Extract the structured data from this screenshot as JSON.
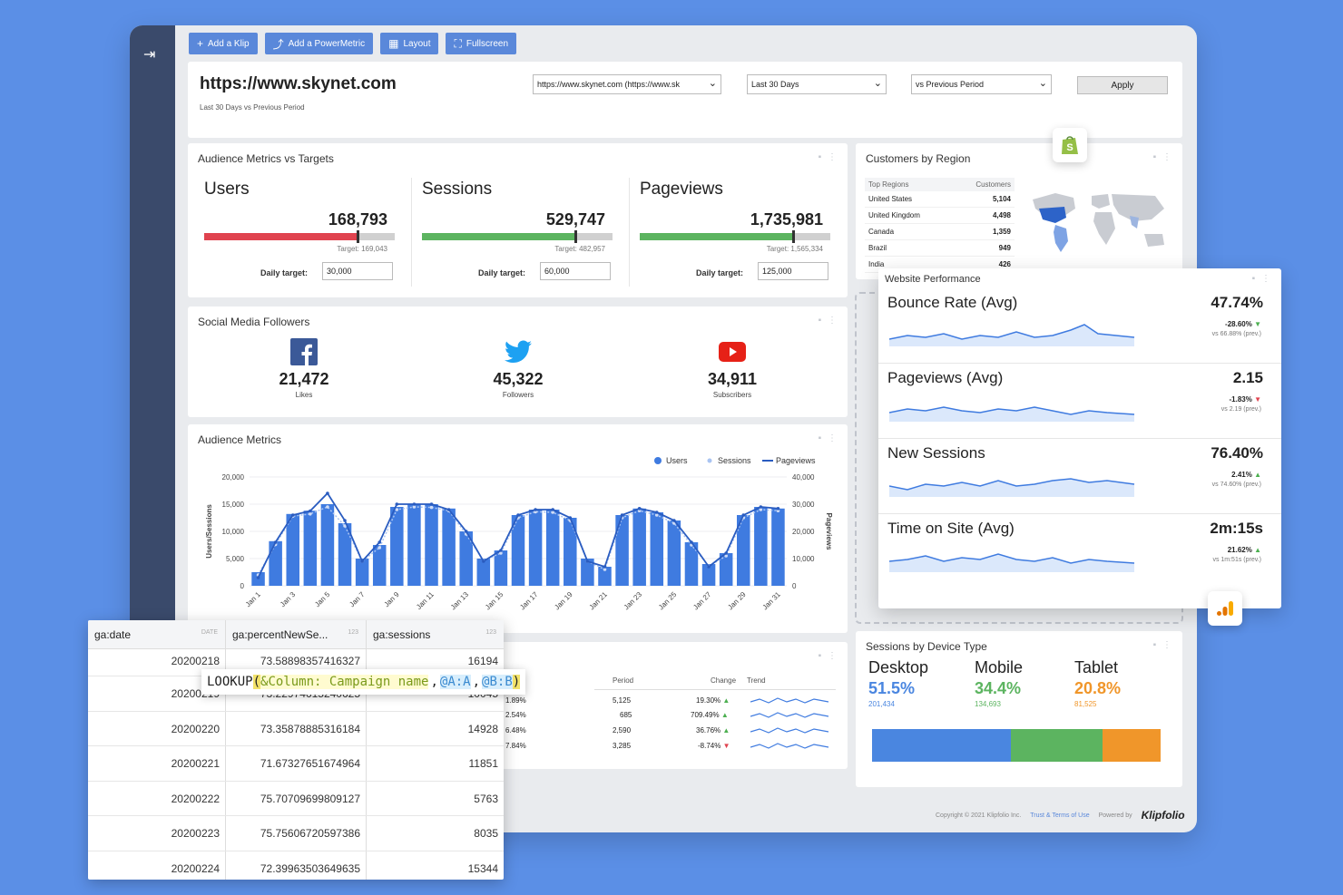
{
  "toolbar": {
    "add_klip": "Add a Klip",
    "add_powermetric": "Add a PowerMetric",
    "layout": "Layout",
    "fullscreen": "Fullscreen"
  },
  "header": {
    "title": "https://www.skynet.com",
    "subtitle": "Last 30 Days vs Previous Period",
    "site_select": "https://www.skynet.com (https://www.sk",
    "range_select": "Last 30 Days",
    "compare_select": "vs Previous Period",
    "apply": "Apply"
  },
  "targets": {
    "title": "Audience Metrics vs Targets",
    "daily_target_label": "Daily target:",
    "metrics": [
      {
        "name": "Users",
        "value": "168,793",
        "target": "Target: 169,043",
        "daily": "30,000",
        "fill": 0.8,
        "color": "#e0434f"
      },
      {
        "name": "Sessions",
        "value": "529,747",
        "target": "Target: 482,957",
        "daily": "60,000",
        "fill": 0.8,
        "color": "#5cb460"
      },
      {
        "name": "Pageviews",
        "value": "1,735,981",
        "target": "Target: 1,565,334",
        "daily": "125,000",
        "fill": 0.8,
        "color": "#5cb460"
      }
    ]
  },
  "social": {
    "title": "Social Media Followers",
    "items": [
      {
        "icon": "facebook-icon",
        "value": "21,472",
        "label": "Likes"
      },
      {
        "icon": "twitter-icon",
        "value": "45,322",
        "label": "Followers"
      },
      {
        "icon": "youtube-icon",
        "value": "34,911",
        "label": "Subscribers"
      }
    ]
  },
  "regions": {
    "title": "Customers by Region",
    "col1": "Top Regions",
    "col2": "Customers",
    "rows": [
      {
        "name": "United States",
        "value": "5,104"
      },
      {
        "name": "United Kingdom",
        "value": "4,498"
      },
      {
        "name": "Canada",
        "value": "1,359"
      },
      {
        "name": "Brazil",
        "value": "949"
      },
      {
        "name": "India",
        "value": "426"
      }
    ]
  },
  "website_performance": {
    "title": "Website Performance",
    "rows": [
      {
        "name": "Bounce Rate (Avg)",
        "value": "47.74%",
        "change": "-28.60%",
        "dir": "down",
        "prev": "vs 66.88% (prev.)"
      },
      {
        "name": "Pageviews (Avg)",
        "value": "2.15",
        "change": "-1.83%",
        "dir": "down",
        "prev": "vs 2.19 (prev.)"
      },
      {
        "name": "New Sessions",
        "value": "76.40%",
        "change": "2.41%",
        "dir": "up",
        "prev": "vs 74.60% (prev.)"
      },
      {
        "name": "Time on Site (Avg)",
        "value": "2m:15s",
        "change": "21.62%",
        "dir": "up",
        "prev": "vs 1m:51s (prev.)"
      }
    ]
  },
  "devices": {
    "title": "Sessions by Device Type",
    "items": [
      {
        "name": "Desktop",
        "pct": "51.5%",
        "count": "201,434",
        "color": "#4a86e0",
        "share": 0.48
      },
      {
        "name": "Mobile",
        "pct": "34.4%",
        "count": "134,693",
        "color": "#5cb460",
        "share": 0.32
      },
      {
        "name": "Tablet",
        "pct": "20.8%",
        "count": "81,525",
        "color": "#f0962a",
        "share": 0.2
      }
    ]
  },
  "campaign": {
    "period_header": "Period",
    "change_header": "Change",
    "trend_header": "Trend",
    "rows": [
      {
        "pct": "1.89%",
        "period": "5,125",
        "change": "19.30%",
        "dir": "up"
      },
      {
        "pct": "2.54%",
        "period": "685",
        "change": "709.49%",
        "dir": "up"
      },
      {
        "pct": "6.48%",
        "period": "2,590",
        "change": "36.76%",
        "dir": "up"
      },
      {
        "pct": "7.84%",
        "period": "3,285",
        "change": "-8.74%",
        "dir": "down"
      }
    ]
  },
  "datatable": {
    "headers": [
      {
        "name": "ga:date",
        "type": "DATE"
      },
      {
        "name": "ga:percentNewSe...",
        "type": "123"
      },
      {
        "name": "ga:sessions",
        "type": "123"
      }
    ],
    "rows": [
      [
        "20200218",
        "73.58898357416327",
        "16194"
      ],
      [
        "20200219",
        "73.22974615240625",
        "10045"
      ],
      [
        "20200220",
        "73.35878885316184",
        "14928"
      ],
      [
        "20200221",
        "71.67327651674964",
        "11851"
      ],
      [
        "20200222",
        "75.70709699809127",
        "5763"
      ],
      [
        "20200223",
        "75.75606720597386",
        "8035"
      ],
      [
        "20200224",
        "72.39963503649635",
        "15344"
      ]
    ]
  },
  "formula": {
    "fn": "LOOKUP",
    "open": "(",
    "arg1": "&Column: Campaign name",
    "sep": ",",
    "arg2": "@A:A",
    "arg3": "@B:B",
    "close": ")"
  },
  "footer": {
    "copyright": "Copyright © 2021 Klipfolio Inc.",
    "terms": "Trust & Terms of Use",
    "powered": "Powered by",
    "brand": "Klipfolio"
  },
  "colors": {
    "accent": "#5a88da",
    "bar": "#3f7be0",
    "line": "#2a5cc0",
    "up": "#4caf50",
    "down": "#e0434f"
  },
  "chart_data": {
    "type": "bar",
    "title": "Audience Metrics",
    "ylabel": "Users/Sessions",
    "y2label": "Pageviews",
    "ylim": [
      0,
      20000
    ],
    "y2lim": [
      0,
      40000
    ],
    "yticks": [
      "20,000",
      "15,000",
      "10,000",
      "5,000",
      "0"
    ],
    "y2ticks": [
      "40,000",
      "30,000",
      "20,000",
      "10,000",
      "0"
    ],
    "legend": [
      "Users",
      "Sessions",
      "Pageviews"
    ],
    "categories": [
      "Jan 1",
      "Jan 2",
      "Jan 3",
      "Jan 4",
      "Jan 5",
      "Jan 6",
      "Jan 7",
      "Jan 8",
      "Jan 9",
      "Jan 10",
      "Jan 11",
      "Jan 12",
      "Jan 13",
      "Jan 14",
      "Jan 15",
      "Jan 16",
      "Jan 17",
      "Jan 18",
      "Jan 19",
      "Jan 20",
      "Jan 21",
      "Jan 22",
      "Jan 23",
      "Jan 24",
      "Jan 25",
      "Jan 26",
      "Jan 27",
      "Jan 28",
      "Jan 29",
      "Jan 30",
      "Jan 31"
    ],
    "xticks": [
      "Jan 1",
      "Jan 3",
      "Jan 5",
      "Jan 7",
      "Jan 9",
      "Jan 11",
      "Jan 13",
      "Jan 15",
      "Jan 17",
      "Jan 19",
      "Jan 21",
      "Jan 23",
      "Jan 25",
      "Jan 27",
      "Jan 29",
      "Jan 31"
    ],
    "series": [
      {
        "name": "Users",
        "values": [
          2500,
          8200,
          13200,
          13800,
          15000,
          11500,
          5000,
          7500,
          14500,
          15000,
          15000,
          14200,
          10000,
          5000,
          6500,
          13000,
          14000,
          14000,
          12500,
          5000,
          3500,
          13000,
          14200,
          13500,
          12000,
          8000,
          4000,
          6000,
          13000,
          14500,
          14200
        ]
      },
      {
        "name": "Sessions",
        "values": [
          2000,
          7600,
          12800,
          13200,
          14500,
          11000,
          4500,
          7000,
          14000,
          14500,
          14400,
          13800,
          9500,
          4600,
          6000,
          12500,
          13600,
          13500,
          12000,
          4500,
          3000,
          12500,
          13800,
          13000,
          11500,
          7500,
          3600,
          5500,
          12500,
          14000,
          13800
        ]
      },
      {
        "name": "Pageviews",
        "values": [
          3000,
          16000,
          26000,
          27500,
          34000,
          24000,
          9000,
          16000,
          30000,
          30000,
          30000,
          28000,
          20000,
          9000,
          13000,
          26000,
          28000,
          28000,
          25000,
          9000,
          7000,
          26000,
          28400,
          27000,
          24000,
          16000,
          7000,
          12000,
          26000,
          29000,
          28400
        ]
      }
    ]
  }
}
